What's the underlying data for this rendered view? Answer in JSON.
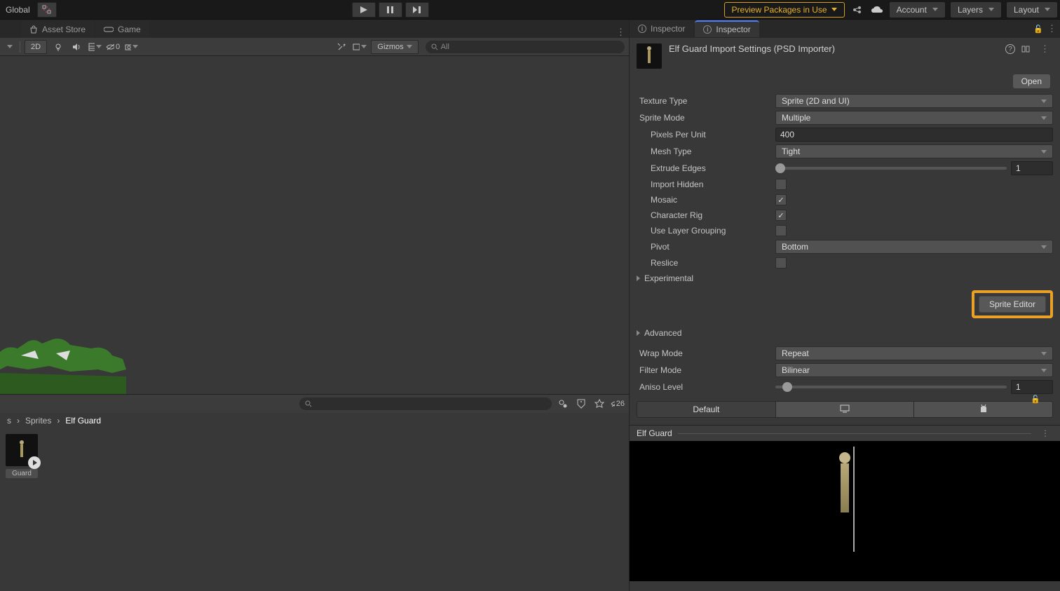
{
  "toolbar": {
    "global": "Global",
    "preview_packages": "Preview Packages in Use",
    "account": "Account",
    "layers": "Layers",
    "layout": "Layout"
  },
  "tabs": {
    "asset_store": "Asset Store",
    "game": "Game",
    "inspector1": "Inspector",
    "inspector2": "Inspector"
  },
  "scene_toolbar": {
    "mode_2d": "2D",
    "hidden_count": "0",
    "gizmos": "Gizmos",
    "search_placeholder": "All"
  },
  "project": {
    "hidden_count": "26",
    "breadcrumb_sprites": "Sprites",
    "breadcrumb_current": "Elf Guard",
    "asset_label": "Guard"
  },
  "inspector": {
    "title": "Elf Guard Import Settings (PSD Importer)",
    "open_btn": "Open",
    "texture_type_label": "Texture Type",
    "texture_type_value": "Sprite (2D and UI)",
    "sprite_mode_label": "Sprite Mode",
    "sprite_mode_value": "Multiple",
    "ppu_label": "Pixels Per Unit",
    "ppu_value": "400",
    "mesh_type_label": "Mesh Type",
    "mesh_type_value": "Tight",
    "extrude_label": "Extrude Edges",
    "extrude_value": "1",
    "import_hidden_label": "Import Hidden",
    "mosaic_label": "Mosaic",
    "character_rig_label": "Character Rig",
    "layer_grouping_label": "Use Layer Grouping",
    "pivot_label": "Pivot",
    "pivot_value": "Bottom",
    "reslice_label": "Reslice",
    "experimental_label": "Experimental",
    "sprite_editor_btn": "Sprite Editor",
    "advanced_label": "Advanced",
    "wrap_mode_label": "Wrap Mode",
    "wrap_mode_value": "Repeat",
    "filter_mode_label": "Filter Mode",
    "filter_mode_value": "Bilinear",
    "aniso_label": "Aniso Level",
    "aniso_value": "1",
    "platform_default": "Default",
    "preview_title": "Elf Guard"
  }
}
